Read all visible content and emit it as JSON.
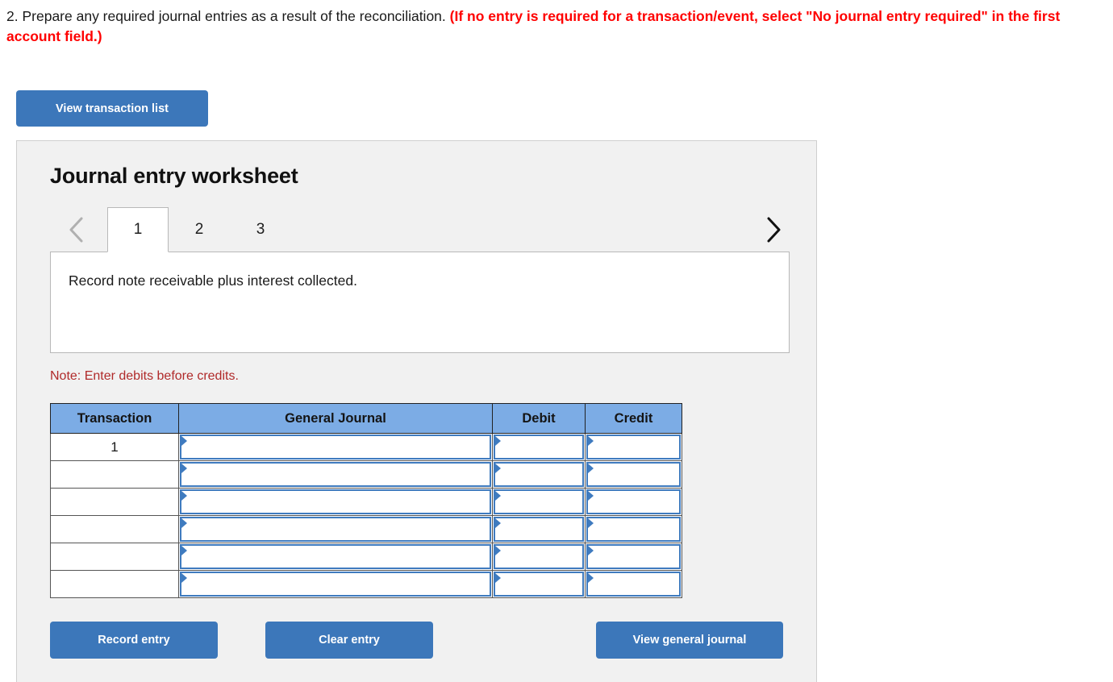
{
  "question": {
    "number": "2.",
    "text": "Prepare any required journal entries as a result of the reconciliation.",
    "emphasis": "(If no entry is required for a transaction/event, select \"No journal entry required\" in the first account field.)"
  },
  "toolbar": {
    "view_transaction_list": "View transaction list"
  },
  "panel": {
    "title": "Journal entry worksheet",
    "prev_icon": "chevron-left-icon",
    "next_icon": "chevron-right-icon",
    "tabs": [
      {
        "label": "1",
        "active": true
      },
      {
        "label": "2",
        "active": false
      },
      {
        "label": "3",
        "active": false
      }
    ],
    "description": "Record note receivable plus interest collected.",
    "note": "Note: Enter debits before credits."
  },
  "table": {
    "columns": [
      "Transaction",
      "General Journal",
      "Debit",
      "Credit"
    ],
    "rows": [
      {
        "transaction": "1",
        "journal": "",
        "debit": "",
        "credit": ""
      },
      {
        "transaction": "",
        "journal": "",
        "debit": "",
        "credit": ""
      },
      {
        "transaction": "",
        "journal": "",
        "debit": "",
        "credit": ""
      },
      {
        "transaction": "",
        "journal": "",
        "debit": "",
        "credit": ""
      },
      {
        "transaction": "",
        "journal": "",
        "debit": "",
        "credit": ""
      },
      {
        "transaction": "",
        "journal": "",
        "debit": "",
        "credit": ""
      }
    ]
  },
  "actions": {
    "record_entry": "Record entry",
    "clear_entry": "Clear entry",
    "view_general_journal": "View general journal"
  },
  "colors": {
    "button_blue": "#3c77ba",
    "header_blue": "#7cace5",
    "field_border_blue": "#3f7bbf",
    "emphasis_red": "#ff0000",
    "note_red": "#b02a2a",
    "panel_bg": "#f1f1f1"
  }
}
